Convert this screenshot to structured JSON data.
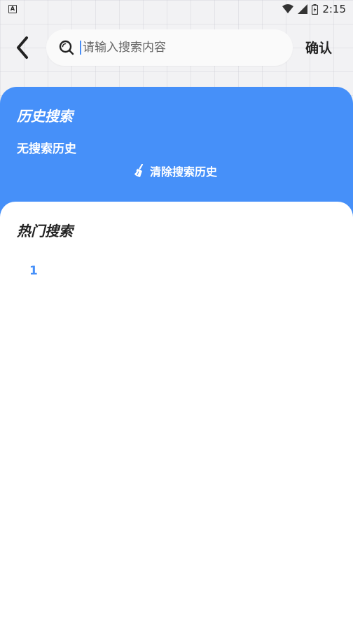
{
  "status_bar": {
    "left_icon": "A",
    "time": "2:15"
  },
  "header": {
    "back_icon": "chevron-left-icon",
    "search_placeholder": "请输入搜索内容",
    "search_value": "",
    "confirm_label": "确认"
  },
  "history": {
    "title": "历史搜索",
    "empty_text": "无搜索历史",
    "clear_label": "清除搜索历史"
  },
  "hot": {
    "title": "热门搜索",
    "items": [
      {
        "rank": "1",
        "text": ""
      }
    ]
  },
  "colors": {
    "accent": "#4690f9",
    "background": "#f2f2f4"
  }
}
